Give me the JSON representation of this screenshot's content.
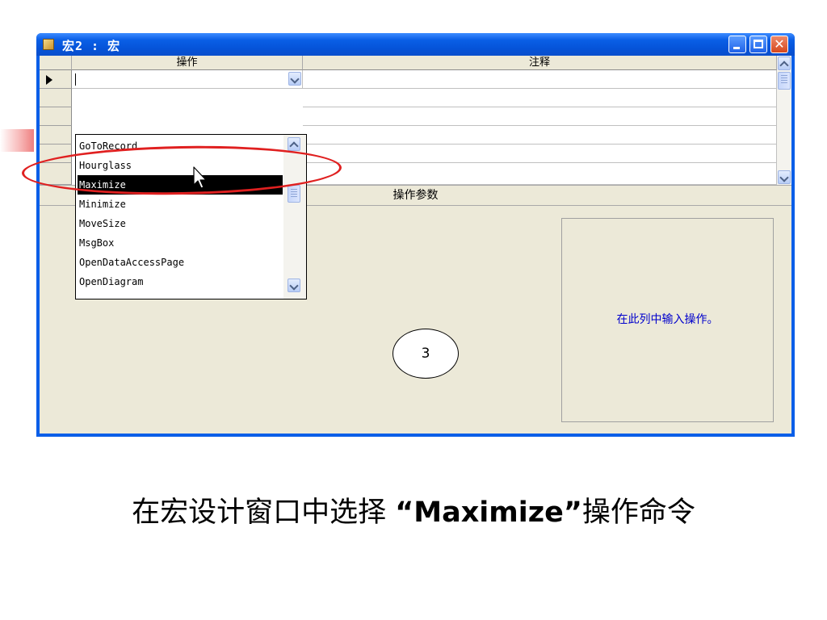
{
  "window": {
    "title": "宏2 : 宏",
    "buttons": {
      "minimize": "minimize-icon",
      "maximize": "maximize-icon",
      "close": "✕"
    }
  },
  "grid": {
    "col_action_header": "操作",
    "col_comment_header": "注释",
    "current_action_value": ""
  },
  "dropdown": {
    "items": [
      {
        "label": "GoToRecord",
        "selected": false
      },
      {
        "label": "Hourglass",
        "selected": false
      },
      {
        "label": "Maximize",
        "selected": true
      },
      {
        "label": "Minimize",
        "selected": false
      },
      {
        "label": "MoveSize",
        "selected": false
      },
      {
        "label": "MsgBox",
        "selected": false
      },
      {
        "label": "OpenDataAccessPage",
        "selected": false
      },
      {
        "label": "OpenDiagram",
        "selected": false
      }
    ]
  },
  "params": {
    "bar_label": "操作参数",
    "help_text": "在此列中输入操作。"
  },
  "annotation": {
    "step_number": "3"
  },
  "caption": {
    "prefix": "在宏设计窗口中选择 ",
    "highlight": "“Maximize”",
    "suffix": "操作命令"
  },
  "colors": {
    "titlebar": "#0553d8",
    "highlight_ellipse": "#e02020",
    "help_text": "#0000cc",
    "selection": "#000000"
  }
}
